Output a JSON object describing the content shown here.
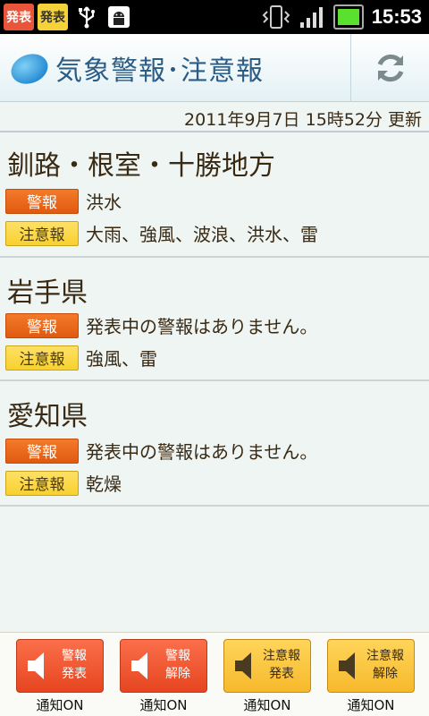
{
  "status_bar": {
    "badge1": "発表",
    "badge2": "発表",
    "icons": [
      "usb-icon",
      "android-debug-icon",
      "vibrate-icon",
      "signal-icon",
      "battery-icon"
    ],
    "time": "15:53"
  },
  "app_bar": {
    "title": "気象警報･注意報",
    "refresh_icon": "refresh-icon"
  },
  "updated": "2011年9月7日 15時52分 更新",
  "tags": {
    "warning": "警報",
    "advisory": "注意報"
  },
  "regions": [
    {
      "name": "釧路・根室・十勝地方",
      "warning": "洪水",
      "advisory": "大雨、強風、波浪、洪水、雷"
    },
    {
      "name": "岩手県",
      "warning": "発表中の警報はありません。",
      "advisory": "強風、雷"
    },
    {
      "name": "愛知県",
      "warning": "発表中の警報はありません。",
      "advisory": "乾燥"
    }
  ],
  "bottom_buttons": [
    {
      "label": "警報\n発表",
      "caption": "通知ON",
      "style": "red"
    },
    {
      "label": "警報\n解除",
      "caption": "通知ON",
      "style": "red"
    },
    {
      "label": "注意報\n発表",
      "caption": "通知ON",
      "style": "yellow"
    },
    {
      "label": "注意報\n解除",
      "caption": "通知ON",
      "style": "yellow"
    }
  ],
  "colors": {
    "warning": "#f06a20",
    "advisory": "#f8d12e",
    "title": "#2b5c86"
  }
}
